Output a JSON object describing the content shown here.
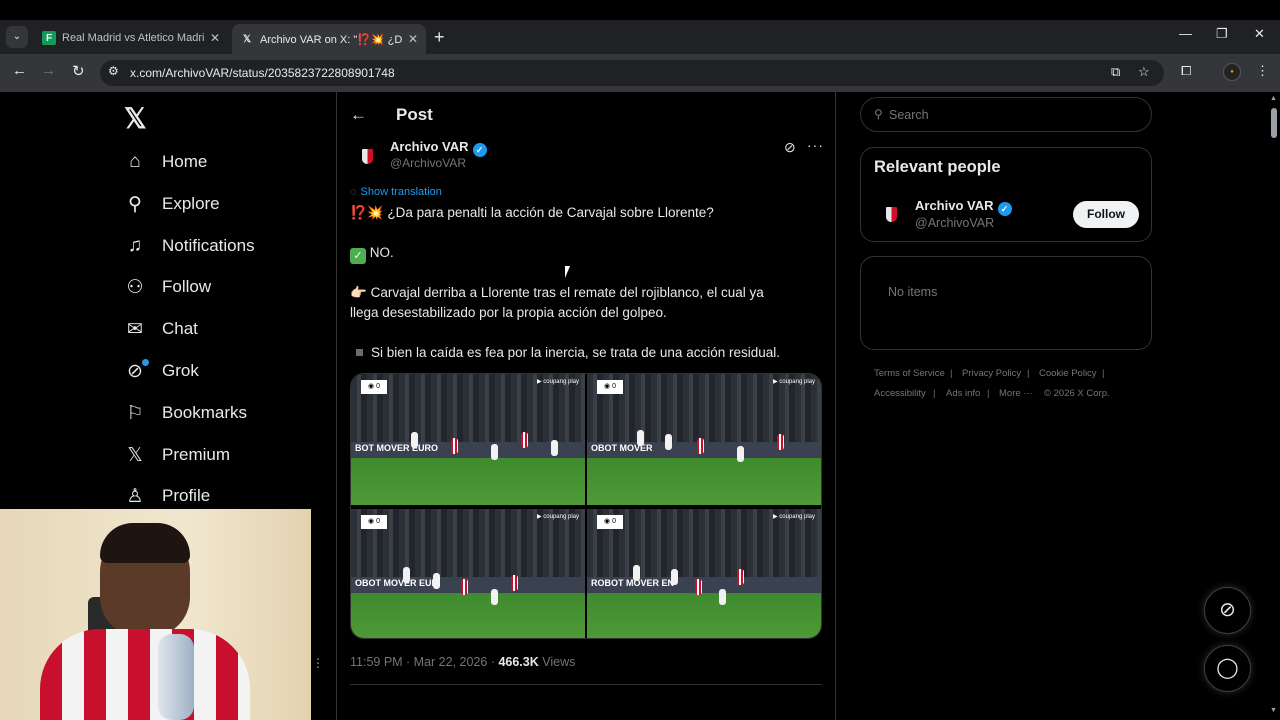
{
  "browser": {
    "tabs": [
      {
        "title": "Real Madrid vs Atletico Madrid",
        "favicon": "sheets-icon",
        "color": "#0f9d58"
      },
      {
        "title": "Archivo VAR on X: \"⁉️💥 ¿Da para",
        "favicon": "x-icon",
        "color": "#000000"
      }
    ],
    "url": "x.com/ArchivoVAR/status/2035823722808901748"
  },
  "nav": {
    "logo": "𝕏",
    "items": [
      {
        "label": "Home",
        "icon": "home-icon"
      },
      {
        "label": "Explore",
        "icon": "search-icon"
      },
      {
        "label": "Notifications",
        "icon": "bell-icon"
      },
      {
        "label": "Follow",
        "icon": "follow-icon"
      },
      {
        "label": "Chat",
        "icon": "mail-icon"
      },
      {
        "label": "Grok",
        "icon": "grok-icon"
      },
      {
        "label": "Bookmarks",
        "icon": "bookmark-icon"
      },
      {
        "label": "Premium",
        "icon": "x-icon"
      },
      {
        "label": "Profile",
        "icon": "person-icon"
      }
    ]
  },
  "post": {
    "header_title": "Post",
    "author_name": "Archivo VAR",
    "author_handle": "@ArchivoVAR",
    "show_translation": "Show translation",
    "line1_emoji_a": "⁉️",
    "line1_emoji_b": "💥",
    "line1_text": " ¿Da para penalti la acción de Carvajal sobre Llorente?",
    "line2_text": " NO.",
    "line3_emoji": "👉🏻",
    "line3_text": " Carvajal derriba a Llorente tras el remate del rojiblanco, el cual ya",
    "line4_text": "llega desestabilizado por la propia acción del golpeo.",
    "line5_text": "Si bien la caída es fea por la inercia, se trata de una acción residual.",
    "time": "11:59 PM · Mar 22, 2026",
    "views_count": "466.3K",
    "views_label": " Views",
    "media_boards": [
      "BOT MOVER EURO",
      "OBOT MOVER",
      "OBOT MOVER EUR",
      "ROBOT MOVER EN"
    ],
    "media_brand": "▶ coupang play"
  },
  "right": {
    "search_placeholder": "Search",
    "relevant_title": "Relevant people",
    "person_name": "Archivo VAR",
    "person_handle": "@ArchivoVAR",
    "follow_label": "Follow",
    "no_items": "No items",
    "footer": {
      "tos": "Terms of Service",
      "privacy": "Privacy Policy",
      "cookie": "Cookie Policy",
      "accessibility": "Accessibility",
      "ads": "Ads info",
      "more": "More ···",
      "copyright": "© 2026 X Corp."
    }
  },
  "colors": {
    "accent": "#1d9bf0",
    "background": "#000000",
    "muted": "#71767b"
  }
}
